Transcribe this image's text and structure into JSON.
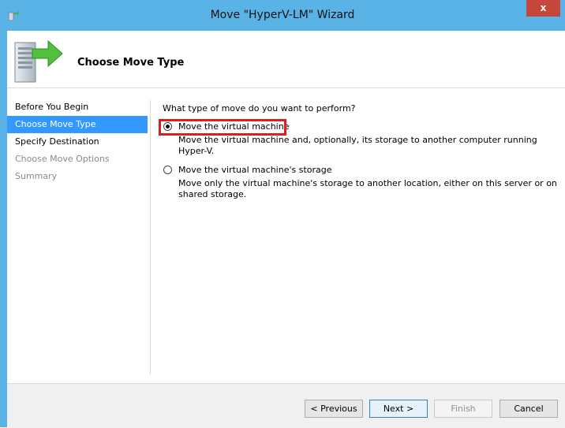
{
  "window": {
    "title": "Move \"HyperV-LM\" Wizard",
    "close_label": "x"
  },
  "header": {
    "title": "Choose Move Type"
  },
  "nav": {
    "items": [
      {
        "label": "Before You Begin",
        "state": "normal"
      },
      {
        "label": "Choose Move Type",
        "state": "active"
      },
      {
        "label": "Specify Destination",
        "state": "normal"
      },
      {
        "label": "Choose Move Options",
        "state": "disabled"
      },
      {
        "label": "Summary",
        "state": "disabled"
      }
    ]
  },
  "content": {
    "question": "What type of move do you want to perform?",
    "options": [
      {
        "label": "Move the virtual machine",
        "selected": true,
        "description": "Move the virtual machine and, optionally, its storage to another computer running Hyper-V."
      },
      {
        "label": "Move the virtual machine's storage",
        "selected": false,
        "description": "Move only the virtual machine's storage to another location, either on this server or on shared storage."
      }
    ]
  },
  "buttons": {
    "previous": "< Previous",
    "next": "Next >",
    "finish": "Finish",
    "cancel": "Cancel"
  },
  "colors": {
    "titlebar": "#5ab3e6",
    "close": "#c7463b",
    "nav_active": "#3399ff",
    "highlight": "#e41b1b"
  },
  "icons": {
    "title": "vm-move-icon",
    "header": "server-arrow-icon"
  }
}
